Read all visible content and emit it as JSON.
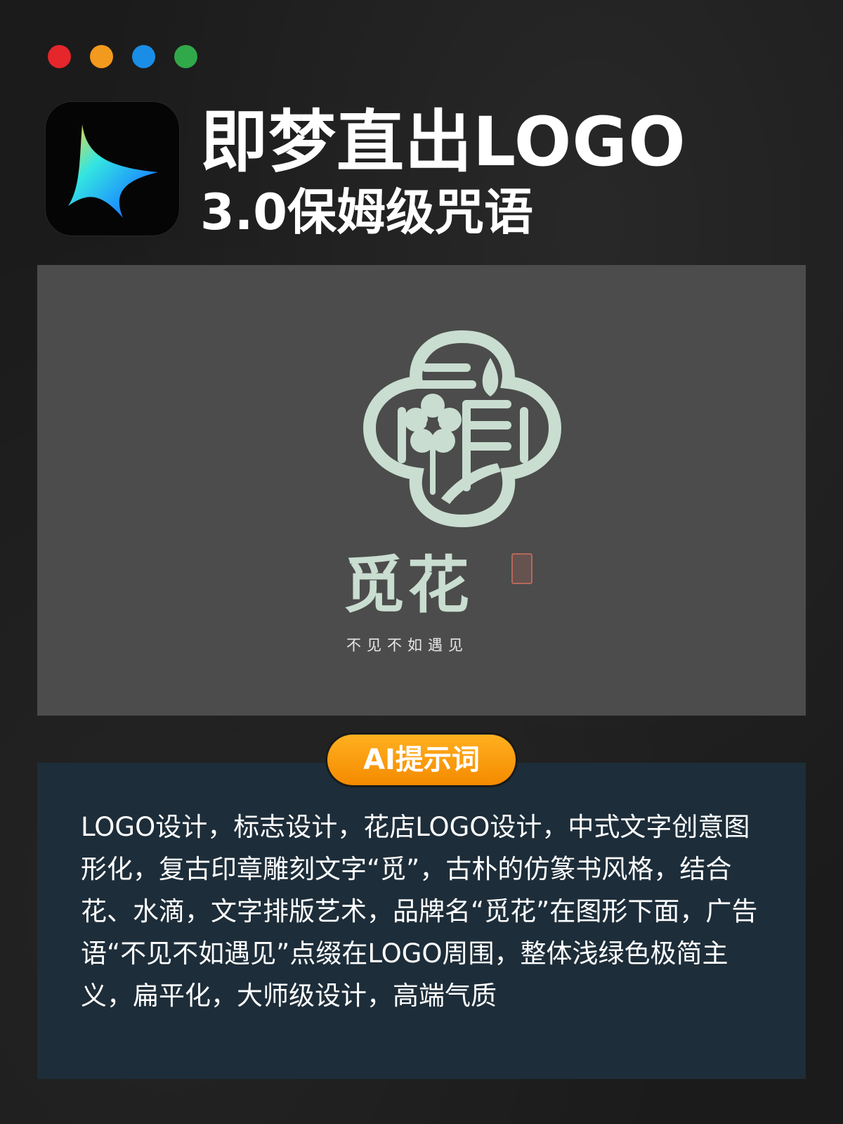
{
  "window_dots": {
    "colors": [
      "#e5262b",
      "#f29a1d",
      "#1a8ee6",
      "#31a84a"
    ]
  },
  "app_icon": {
    "name": "jimeng-app-icon"
  },
  "header": {
    "title": "即梦直出LOGO",
    "subtitle": "3.0保姆级咒语"
  },
  "preview": {
    "brand_name": "觅花",
    "slogan": "不见不如遇见",
    "logo_color": "#c9ddd0",
    "background": "#4c4c4c"
  },
  "prompt_section": {
    "badge_label": "AI提示词",
    "text": "LOGO设计，标志设计，花店LOGO设计，中式文字创意图形化，复古印章雕刻文字“觅”，古朴的仿篆书风格，结合花、水滴，文字排版艺术，品牌名“觅花”在图形下面，广告语“不见不如遇见”点缀在LOGO周围，整体浅绿色极简主义，扁平化，大师级设计，高端气质"
  }
}
